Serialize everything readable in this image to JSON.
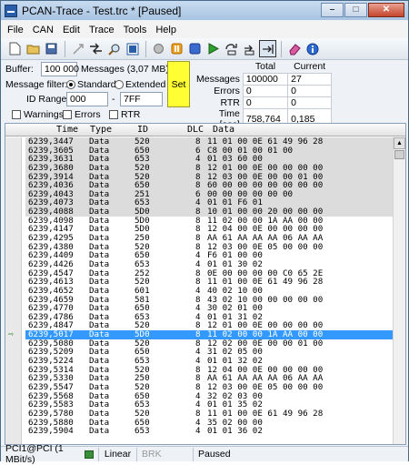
{
  "window": {
    "title": "PCAN-Trace - Test.trc * [Paused]"
  },
  "menu": [
    "File",
    "CAN",
    "Edit",
    "Trace",
    "Tools",
    "Help"
  ],
  "controls": {
    "buffer_label": "Buffer:",
    "buffer_value": "100 000",
    "buffer_info": "Messages (3,07 MB)",
    "filter_label": "Message filter:",
    "standard_label": "Standard",
    "extended_label": "Extended",
    "id_range_label": "ID Range:",
    "id_from": "000",
    "id_sep": "-",
    "id_to": "7FF",
    "set_label": "Set",
    "warnings_label": "Warnings",
    "errors_label": "Errors",
    "rtr_label": "RTR"
  },
  "stats": {
    "col_total": "Total",
    "col_current": "Current",
    "rows": [
      {
        "label": "Messages",
        "total": "100000",
        "current": "27"
      },
      {
        "label": "Errors",
        "total": "0",
        "current": "0"
      },
      {
        "label": "RTR",
        "total": "0",
        "current": "0"
      },
      {
        "label": "Time [sec]",
        "total": "758,764",
        "current": "0,185"
      }
    ]
  },
  "list": {
    "headers": {
      "time": "Time",
      "type": "Type",
      "id": "ID",
      "dlc": "DLC",
      "data": "Data"
    },
    "rows": [
      {
        "time": "6239,3447",
        "type": "Data",
        "id": "520",
        "dlc": "8",
        "data": "11 01 00 0E 61 49 96 28",
        "style": "old"
      },
      {
        "time": "6239,3605",
        "type": "Data",
        "id": "650",
        "dlc": "6",
        "data": "C8 00 01 00 01 00",
        "style": "old"
      },
      {
        "time": "6239,3631",
        "type": "Data",
        "id": "653",
        "dlc": "4",
        "data": "01 03 60 00",
        "style": "old"
      },
      {
        "time": "6239,3680",
        "type": "Data",
        "id": "520",
        "dlc": "8",
        "data": "12 01 00 0E 00 00 00 00",
        "style": "old"
      },
      {
        "time": "6239,3914",
        "type": "Data",
        "id": "520",
        "dlc": "8",
        "data": "12 03 00 0E 00 00 01 00",
        "style": "old"
      },
      {
        "time": "6239,4036",
        "type": "Data",
        "id": "650",
        "dlc": "8",
        "data": "60 00 00 00 00 00 00 00",
        "style": "old"
      },
      {
        "time": "6239,4043",
        "type": "Data",
        "id": "251",
        "dlc": "6",
        "data": "00 00 00 00 00 00",
        "style": "old"
      },
      {
        "time": "6239,4073",
        "type": "Data",
        "id": "653",
        "dlc": "4",
        "data": "01 01 F6 01",
        "style": "old"
      },
      {
        "time": "6239,4088",
        "type": "Data",
        "id": "5D0",
        "dlc": "8",
        "data": "10 01 00 00 20 00 00 00",
        "style": "old"
      },
      {
        "time": "6239,4098",
        "type": "Data",
        "id": "5D0",
        "dlc": "8",
        "data": "11 02 00 00 1A AA 00 00",
        "style": ""
      },
      {
        "time": "6239,4147",
        "type": "Data",
        "id": "5D0",
        "dlc": "8",
        "data": "12 04 00 0E 00 00 00 00",
        "style": ""
      },
      {
        "time": "6239,4295",
        "type": "Data",
        "id": "250",
        "dlc": "8",
        "data": "AA 61 AA AA AA 06 AA AA",
        "style": ""
      },
      {
        "time": "6239,4380",
        "type": "Data",
        "id": "520",
        "dlc": "8",
        "data": "12 03 00 0E 05 00 00 00",
        "style": ""
      },
      {
        "time": "6239,4409",
        "type": "Data",
        "id": "650",
        "dlc": "4",
        "data": "F6 01 00 00",
        "style": ""
      },
      {
        "time": "6239,4426",
        "type": "Data",
        "id": "653",
        "dlc": "4",
        "data": "01 01 30 02",
        "style": ""
      },
      {
        "time": "6239,4547",
        "type": "Data",
        "id": "252",
        "dlc": "8",
        "data": "0E 00 00 00 00 C0 65 2E",
        "style": ""
      },
      {
        "time": "6239,4613",
        "type": "Data",
        "id": "520",
        "dlc": "8",
        "data": "11 01 00 0E 61 49 96 28",
        "style": ""
      },
      {
        "time": "6239,4652",
        "type": "Data",
        "id": "601",
        "dlc": "4",
        "data": "40 02 10 00",
        "style": ""
      },
      {
        "time": "6239,4659",
        "type": "Data",
        "id": "581",
        "dlc": "8",
        "data": "43 02 10 00 00 00 00 00",
        "style": ""
      },
      {
        "time": "6239,4770",
        "type": "Data",
        "id": "650",
        "dlc": "4",
        "data": "30 02 01 00",
        "style": ""
      },
      {
        "time": "6239,4786",
        "type": "Data",
        "id": "653",
        "dlc": "4",
        "data": "01 01 31 02",
        "style": ""
      },
      {
        "time": "6239,4847",
        "type": "Data",
        "id": "520",
        "dlc": "8",
        "data": "12 01 00 0E 00 00 00 00",
        "style": ""
      },
      {
        "time": "6239,5017",
        "type": "Data",
        "id": "5D0",
        "dlc": "8",
        "data": "11 02 00 00 1A AA 00 00",
        "style": "sel"
      },
      {
        "time": "6239,5080",
        "type": "Data",
        "id": "520",
        "dlc": "8",
        "data": "12 02 00 0E 00 00 01 00",
        "style": ""
      },
      {
        "time": "6239,5209",
        "type": "Data",
        "id": "650",
        "dlc": "4",
        "data": "31 02 05 00",
        "style": ""
      },
      {
        "time": "6239,5224",
        "type": "Data",
        "id": "653",
        "dlc": "4",
        "data": "01 01 32 02",
        "style": ""
      },
      {
        "time": "6239,5314",
        "type": "Data",
        "id": "520",
        "dlc": "8",
        "data": "12 04 00 0E 00 00 00 00",
        "style": ""
      },
      {
        "time": "6239,5330",
        "type": "Data",
        "id": "250",
        "dlc": "8",
        "data": "AA 61 AA AA AA 06 AA AA",
        "style": ""
      },
      {
        "time": "6239,5547",
        "type": "Data",
        "id": "520",
        "dlc": "8",
        "data": "12 03 00 0E 05 00 00 00",
        "style": ""
      },
      {
        "time": "6239,5568",
        "type": "Data",
        "id": "650",
        "dlc": "4",
        "data": "32 02 03 00",
        "style": ""
      },
      {
        "time": "6239,5583",
        "type": "Data",
        "id": "653",
        "dlc": "4",
        "data": "01 01 35 02",
        "style": ""
      },
      {
        "time": "6239,5780",
        "type": "Data",
        "id": "520",
        "dlc": "8",
        "data": "11 01 00 0E 61 49 96 28",
        "style": ""
      },
      {
        "time": "6239,5880",
        "type": "Data",
        "id": "650",
        "dlc": "4",
        "data": "35 02 00 00",
        "style": ""
      },
      {
        "time": "6239,5904",
        "type": "Data",
        "id": "653",
        "dlc": "4",
        "data": "01 01 36 02",
        "style": ""
      }
    ]
  },
  "status": {
    "hardware": "PCI1@PCI (1 MBit/s)",
    "mode": "Linear",
    "brk": "BRK",
    "state": "Paused"
  },
  "colors": {
    "selection": "#3399ff",
    "old_rows": "#dcdcdc",
    "set_button": "#ffff33"
  }
}
